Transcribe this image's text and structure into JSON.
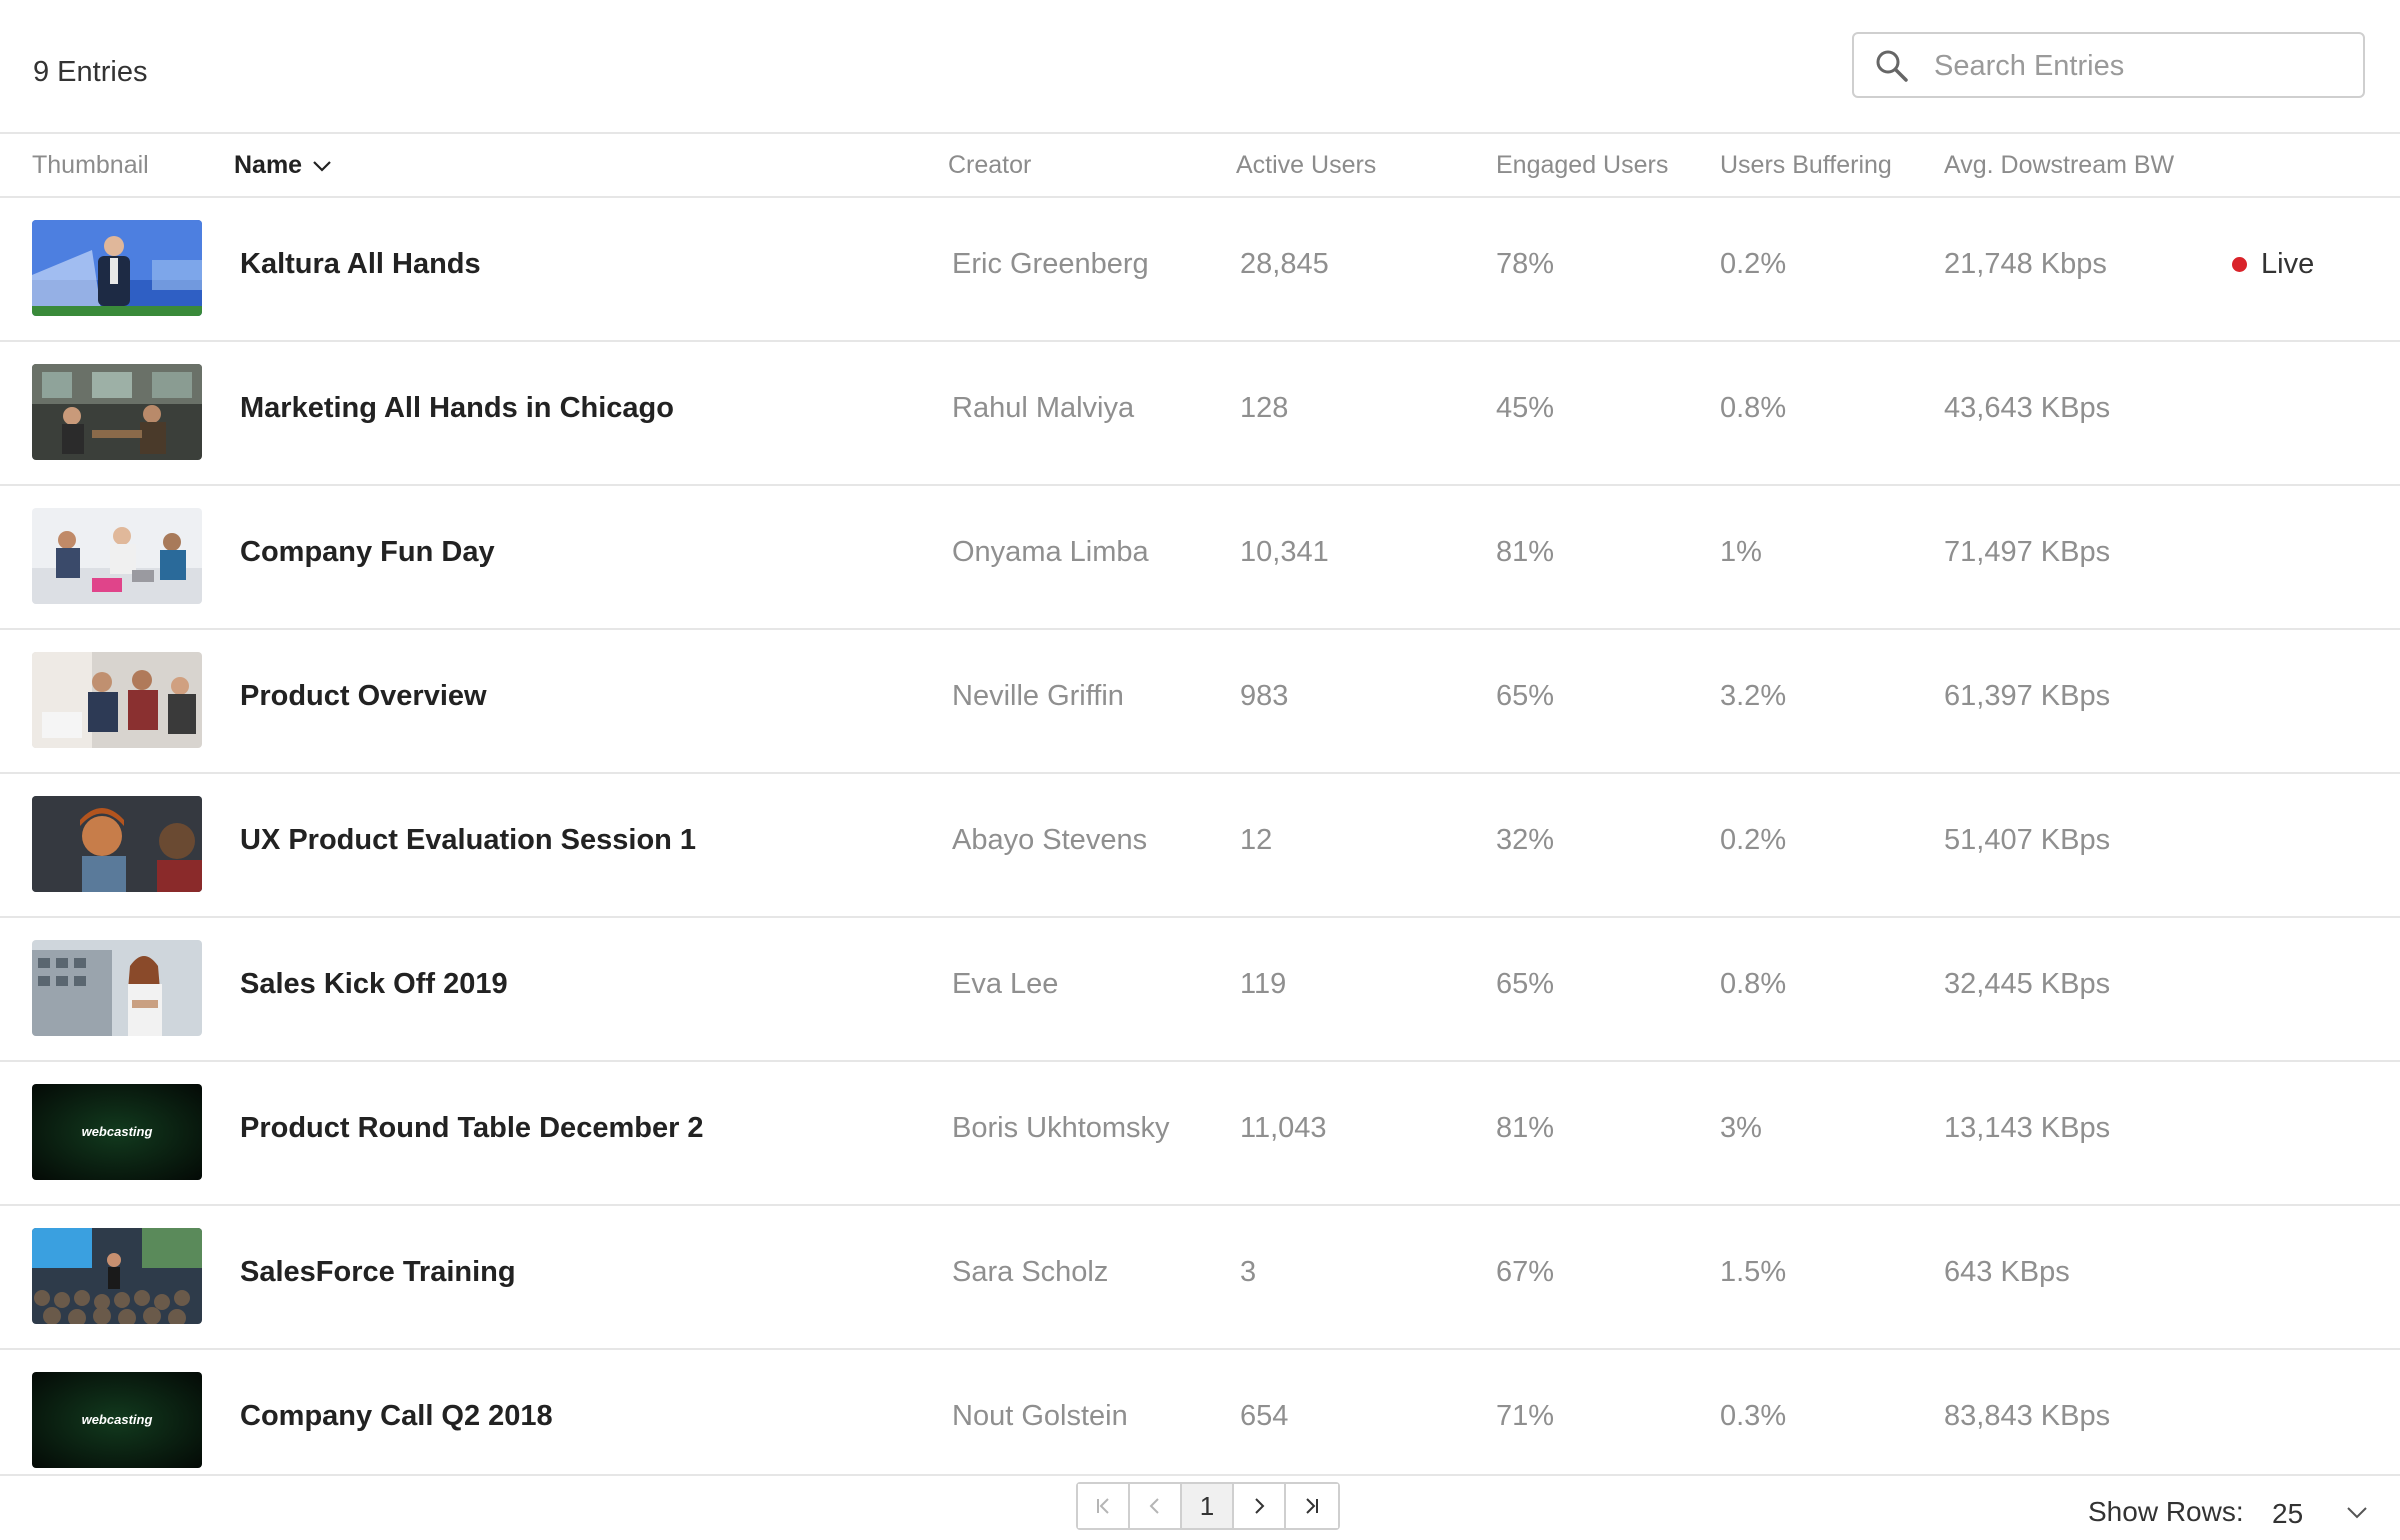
{
  "header": {
    "entries_count": "9 Entries",
    "search_placeholder": "Search Entries"
  },
  "columns": {
    "thumbnail": "Thumbnail",
    "name": "Name",
    "creator": "Creator",
    "active_users": "Active Users",
    "engaged_users": "Engaged Users",
    "users_buffering": "Users Buffering",
    "avg_bw": "Avg. Dowstream BW"
  },
  "rows": [
    {
      "name": "Kaltura All Hands",
      "creator": "Eric Greenberg",
      "active_users": "28,845",
      "engaged_users": "78%",
      "users_buffering": "0.2%",
      "avg_bw": "21,748 Kbps",
      "status": "Live",
      "thumb": "keynote-speaker"
    },
    {
      "name": "Marketing All Hands in Chicago",
      "creator": "Rahul Malviya",
      "active_users": "128",
      "engaged_users": "45%",
      "users_buffering": "0.8%",
      "avg_bw": "43,643 KBps",
      "status": "",
      "thumb": "office-meeting"
    },
    {
      "name": "Company Fun Day",
      "creator": "Onyama Limba",
      "active_users": "10,341",
      "engaged_users": "81%",
      "users_buffering": "1%",
      "avg_bw": "71,497 KBps",
      "status": "",
      "thumb": "people-laptops"
    },
    {
      "name": "Product Overview",
      "creator": "Neville Griffin",
      "active_users": "983",
      "engaged_users": "65%",
      "users_buffering": "3.2%",
      "avg_bw": "61,397 KBps",
      "status": "",
      "thumb": "team-desk"
    },
    {
      "name": "UX Product Evaluation Session 1",
      "creator": "Abayo Stevens",
      "active_users": "12",
      "engaged_users": "32%",
      "users_buffering": "0.2%",
      "avg_bw": "51,407 KBps",
      "status": "",
      "thumb": "two-people"
    },
    {
      "name": "Sales Kick Off 2019",
      "creator": "Eva Lee",
      "active_users": "119",
      "engaged_users": "65%",
      "users_buffering": "0.8%",
      "avg_bw": "32,445 KBps",
      "status": "",
      "thumb": "woman-building"
    },
    {
      "name": "Product Round Table December 2",
      "creator": "Boris Ukhtomsky",
      "active_users": "11,043",
      "engaged_users": "81%",
      "users_buffering": "3%",
      "avg_bw": "13,143 KBps",
      "status": "",
      "thumb": "webcasting-logo",
      "thumb_text": "webcasting"
    },
    {
      "name": "SalesForce Training",
      "creator": "Sara Scholz",
      "active_users": "3",
      "engaged_users": "67%",
      "users_buffering": "1.5%",
      "avg_bw": "643 KBps",
      "status": "",
      "thumb": "conference-audience"
    },
    {
      "name": "Company Call Q2 2018",
      "creator": "Nout Golstein",
      "active_users": "654",
      "engaged_users": "71%",
      "users_buffering": "0.3%",
      "avg_bw": "83,843 KBps",
      "status": "",
      "thumb": "webcasting-logo",
      "thumb_text": "webcasting"
    }
  ],
  "pagination": {
    "current_page": "1",
    "show_rows_label": "Show Rows:",
    "rows_per_page": "25"
  },
  "colors": {
    "live_dot": "#d9232a",
    "row_border": "#e6e6e6"
  }
}
